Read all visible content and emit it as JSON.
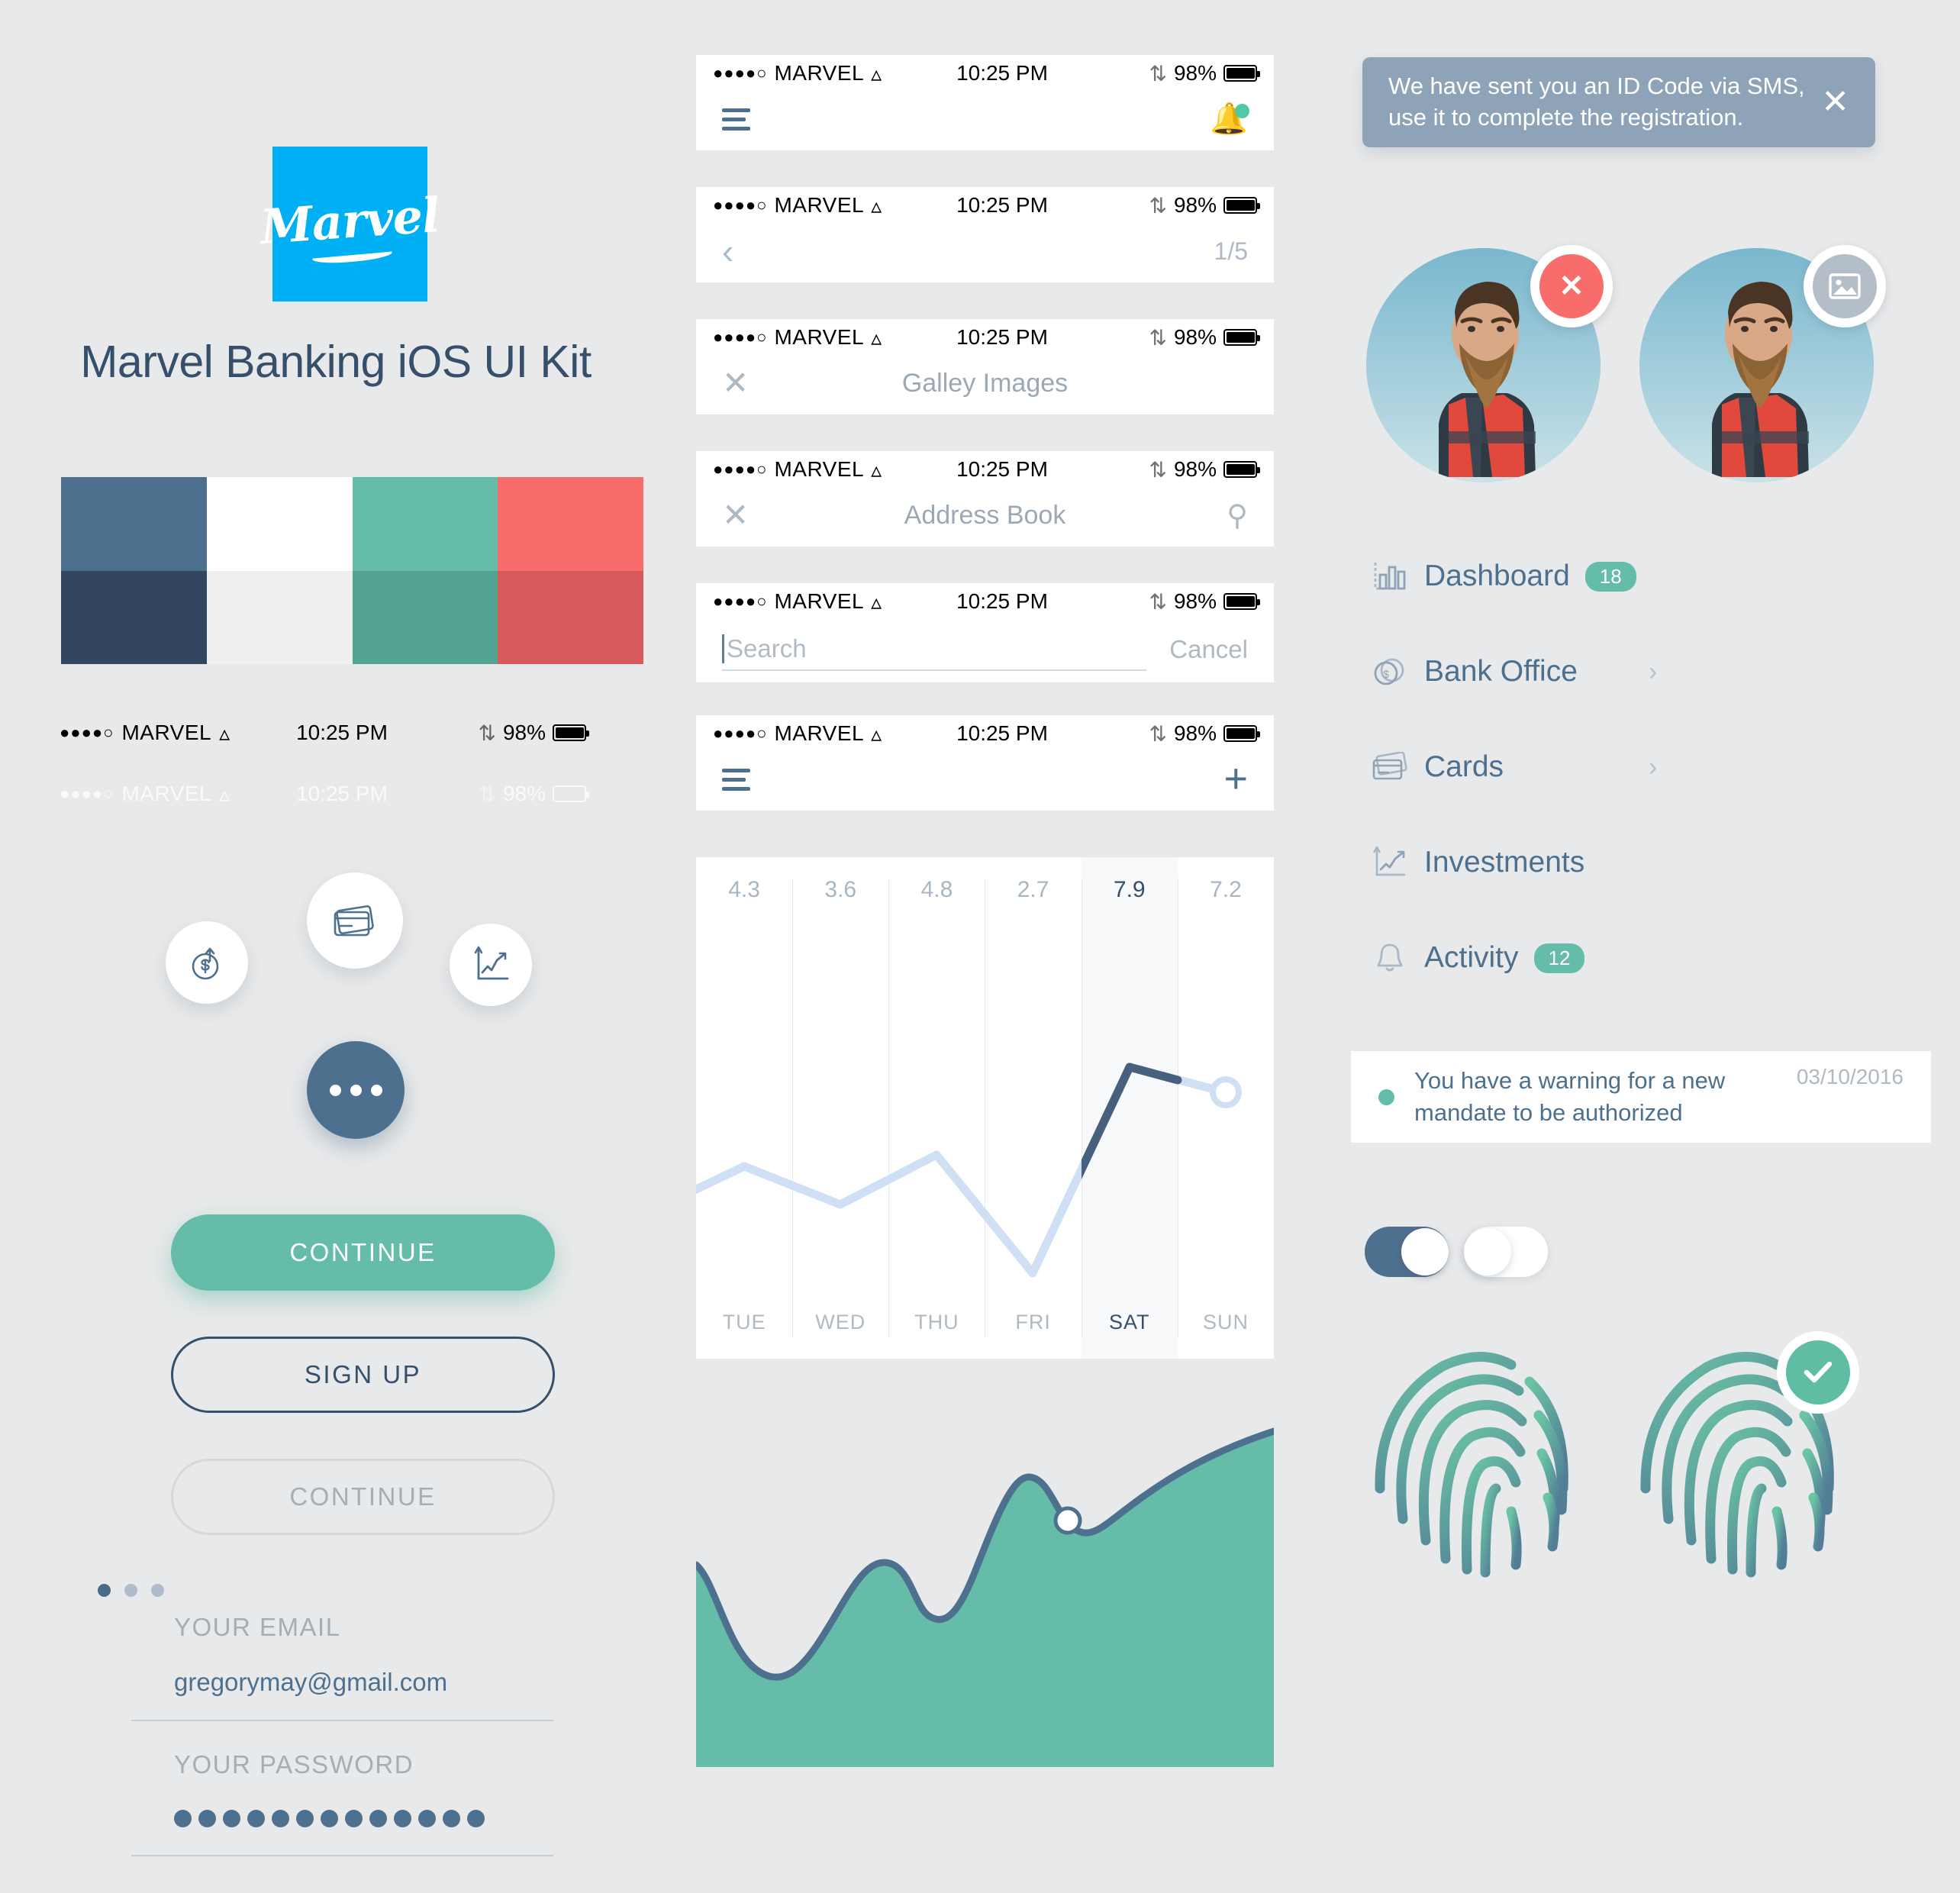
{
  "brand": {
    "logo_text": "Marvel",
    "logo_bg": "#00B0F5",
    "title": "Marvel Banking iOS UI Kit",
    "title_color": "#36506B"
  },
  "palette": {
    "label": "color-palette",
    "swatches": [
      {
        "name": "slate-blue",
        "hex": "#4E708F"
      },
      {
        "name": "white",
        "hex": "#FFFFFF"
      },
      {
        "name": "teal",
        "hex": "#65BCA8"
      },
      {
        "name": "coral",
        "hex": "#F96C6C"
      },
      {
        "name": "navy",
        "hex": "#32475F"
      },
      {
        "name": "light-gray",
        "hex": "#EFEFEF"
      },
      {
        "name": "teal-dark",
        "hex": "#54A292"
      },
      {
        "name": "coral-dark",
        "hex": "#D95A5A"
      }
    ]
  },
  "statusbar": {
    "signal_dots": "●●●●○",
    "carrier": "MARVEL",
    "wifi": "wifi-icon",
    "time": "10:25 PM",
    "bluetooth": "bluetooth-icon",
    "battery_pct": "98%"
  },
  "fabs": [
    {
      "name": "transfer-money-fab",
      "icon": "dollar-arrow-icon"
    },
    {
      "name": "cards-fab",
      "icon": "credit-card-icon"
    },
    {
      "name": "chart-fab",
      "icon": "line-chart-icon"
    },
    {
      "name": "more-fab",
      "icon": "more-dots-icon"
    }
  ],
  "buttons": {
    "primary": "CONTINUE",
    "outline": "SIGN UP",
    "disabled": "CONTINUE"
  },
  "pager_dots": {
    "total": 3,
    "active_index": 0
  },
  "form": {
    "email_label": "YOUR EMAIL",
    "email_value": "gregorymay@gmail.com",
    "password_label": "YOUR PASSWORD",
    "password_masked_count": 13
  },
  "navbars": [
    {
      "name": "navbar-menu-notify",
      "left_icon": "hamburger-icon",
      "title": "",
      "right_icon": "bell-icon",
      "has_badge_dot": true
    },
    {
      "name": "navbar-back-pager",
      "left_icon": "chevron-left-icon",
      "title": "",
      "right_text": "1/5"
    },
    {
      "name": "navbar-gallery",
      "left_icon": "close-x-icon",
      "title": "Galley Images",
      "right_icon": ""
    },
    {
      "name": "navbar-address-book",
      "left_icon": "close-x-icon",
      "title": "Address Book",
      "right_icon": "search-icon"
    },
    {
      "name": "navbar-search",
      "search_placeholder": "Search",
      "cancel_label": "Cancel"
    },
    {
      "name": "navbar-menu-add",
      "left_icon": "hamburger-icon",
      "title": "",
      "right_icon": "plus-icon"
    }
  ],
  "chart_data": [
    {
      "type": "line",
      "title": "",
      "categories": [
        "TUE",
        "WED",
        "THU",
        "FRI",
        "SAT",
        "SUN"
      ],
      "values": [
        4.3,
        3.6,
        4.8,
        2.7,
        7.9,
        7.2
      ],
      "value_labels": [
        "4.3",
        "3.6",
        "4.8",
        "2.7",
        "7.9",
        "7.2"
      ],
      "highlight_category": "SAT",
      "highlight_index": 4,
      "xlabel": "",
      "ylabel": "",
      "ylim": [
        2.0,
        8.4
      ],
      "grid": true,
      "legend": "none",
      "series_colors": {
        "base": "#CFE0F5",
        "highlight": "#46607E"
      },
      "end_marker": true
    },
    {
      "type": "area",
      "title": "",
      "x": [
        0,
        1,
        2,
        3,
        4,
        5,
        6,
        7,
        8,
        9,
        10
      ],
      "values": [
        5.4,
        3.0,
        1.4,
        2.3,
        5.0,
        3.6,
        3.1,
        7.2,
        8.6,
        6.8,
        9.8
      ],
      "xlabel": "",
      "ylabel": "",
      "ylim": [
        0,
        10
      ],
      "grid": false,
      "legend": "none",
      "fill_color": "#65BCA8",
      "stroke_color": "#4E708F",
      "marker_index": 8
    }
  ],
  "toast": {
    "message": "We have sent you an ID Code via SMS, use it to complete the registration.",
    "close_icon": "close-x-icon",
    "bg": "#8EA3B8"
  },
  "avatars": [
    {
      "name": "avatar-remove",
      "badge_icon": "close-x-icon",
      "badge_color": "#F96C6C"
    },
    {
      "name": "avatar-change-photo",
      "badge_icon": "image-icon",
      "badge_color": "#B4BEC8"
    }
  ],
  "menu": {
    "items": [
      {
        "label": "Dashboard",
        "icon": "bar-chart-icon",
        "badge": "18",
        "chevron": false
      },
      {
        "label": "Bank Office",
        "icon": "coins-icon",
        "badge": "",
        "chevron": true
      },
      {
        "label": "Cards",
        "icon": "credit-card-icon",
        "badge": "",
        "chevron": true
      },
      {
        "label": "Investments",
        "icon": "line-chart-icon",
        "badge": "",
        "chevron": false
      },
      {
        "label": "Activity",
        "icon": "bell-icon",
        "badge": "12",
        "chevron": false
      }
    ],
    "badge_color": "#65BCA8"
  },
  "notification": {
    "message": "You have a warning for a new mandate to be authorized",
    "date": "03/10/2016",
    "dot_color": "#65BCA8"
  },
  "toggles": [
    {
      "name": "toggle-on",
      "state": "on",
      "track_color": "#4E708F"
    },
    {
      "name": "toggle-off",
      "state": "off",
      "track_color": "#FFFFFF"
    }
  ],
  "fingerprints": [
    {
      "name": "fingerprint-scan",
      "verified": false
    },
    {
      "name": "fingerprint-verified",
      "verified": true,
      "badge_icon": "check-icon",
      "badge_color": "#5FBDA4"
    }
  ]
}
